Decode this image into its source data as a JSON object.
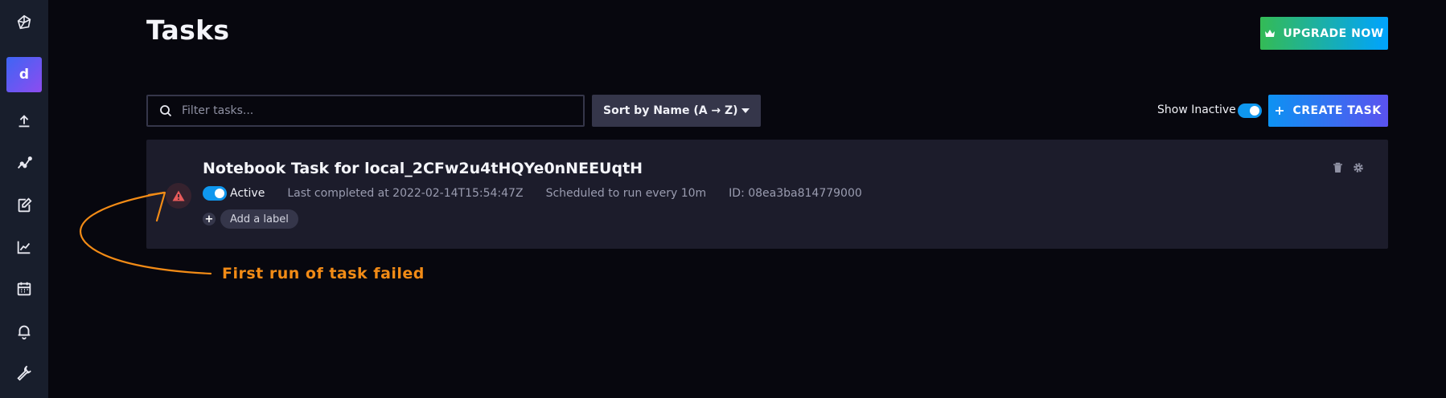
{
  "page": {
    "title": "Tasks",
    "upgrade_label": "UPGRADE NOW"
  },
  "sidebar": {
    "org_initial": "d",
    "items": [
      {
        "icon": "cube-logo-icon"
      },
      {
        "icon": "upload-icon"
      },
      {
        "icon": "graph-icon"
      },
      {
        "icon": "notebook-edit-icon"
      },
      {
        "icon": "chart-icon"
      },
      {
        "icon": "calendar-icon"
      },
      {
        "icon": "bell-icon"
      },
      {
        "icon": "wrench-icon"
      }
    ]
  },
  "toolbar": {
    "search_placeholder": "Filter tasks...",
    "sort_label": "Sort by Name (A → Z)",
    "show_inactive_label": "Show Inactive",
    "create_label": "CREATE TASK"
  },
  "task": {
    "name": "Notebook Task for local_2CFw2u4tHQYe0nNEEUqtH",
    "status": "Active",
    "last_completed": "Last completed at 2022-02-14T15:54:47Z",
    "schedule": "Scheduled to run every 10m",
    "id": "ID: 08ea3ba814779000",
    "add_label": "Add a label"
  },
  "annotation": {
    "text": "First run of task failed"
  },
  "colors": {
    "accent_blue": "#0f97ee",
    "annotation_orange": "#f28b16",
    "error_red": "#e85b5b"
  }
}
